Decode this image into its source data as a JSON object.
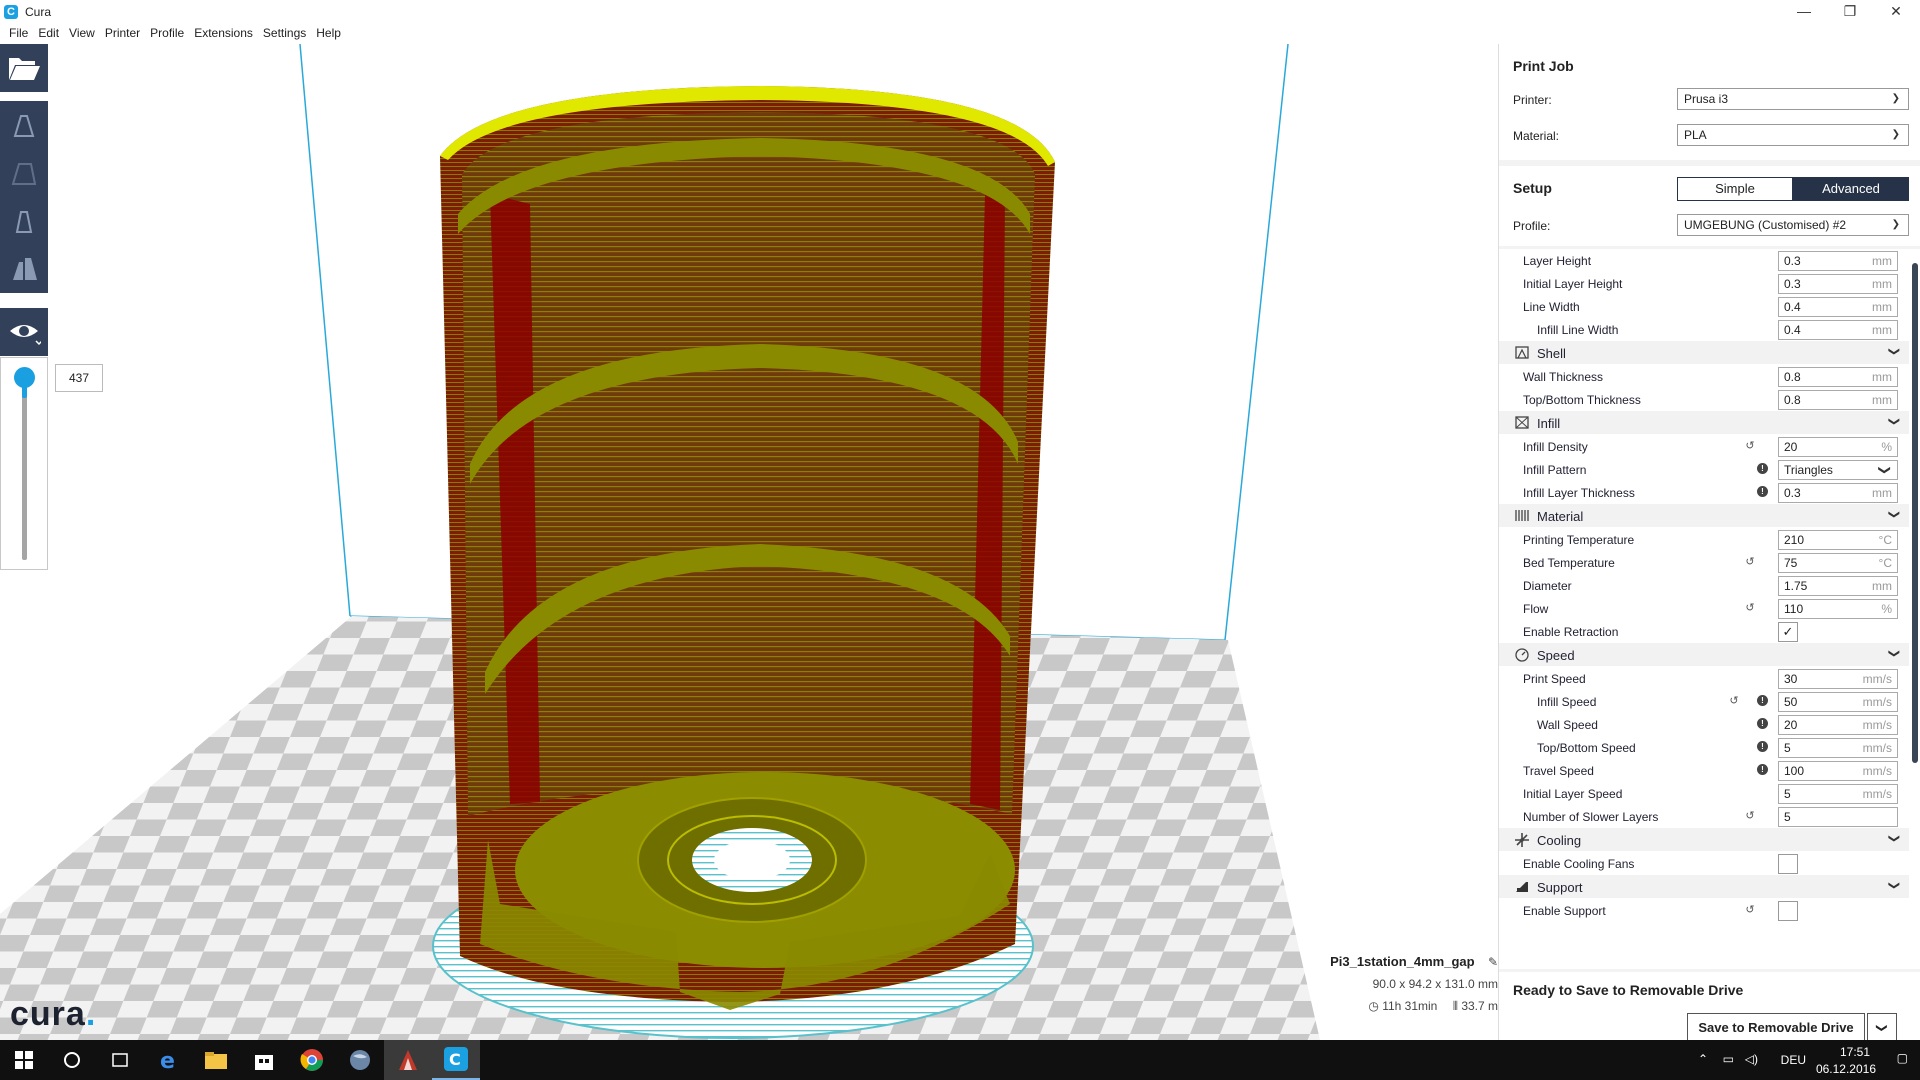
{
  "window": {
    "title": "Cura",
    "logo_letter": "C",
    "minimize": "—",
    "maximize": "❐",
    "close": "✕"
  },
  "menu": [
    "File",
    "Edit",
    "View",
    "Printer",
    "Profile",
    "Extensions",
    "Settings",
    "Help"
  ],
  "layer_view": {
    "current_layer": "437",
    "slider_position": 1.0
  },
  "logo": {
    "text": "cura",
    "dot": "."
  },
  "job": {
    "name": "Pi3_1station_4mm_gap",
    "dimensions": "90.0 x 94.2 x 131.0 mm",
    "time": "11h 31min",
    "filament": "33.7 m"
  },
  "print_job": {
    "heading": "Print Job",
    "printer_label": "Printer:",
    "printer_value": "Prusa i3",
    "material_label": "Material:",
    "material_value": "PLA"
  },
  "setup": {
    "heading": "Setup",
    "mode_simple": "Simple",
    "mode_advanced": "Advanced",
    "active_mode": "Advanced",
    "profile_label": "Profile:",
    "profile_value": "UMGEBUNG (Customised) #2"
  },
  "settings": [
    {
      "kind": "setting",
      "label": "Layer Height",
      "indent": 1,
      "value": "0.3",
      "unit": "mm"
    },
    {
      "kind": "setting",
      "label": "Initial Layer Height",
      "indent": 1,
      "value": "0.3",
      "unit": "mm"
    },
    {
      "kind": "setting",
      "label": "Line Width",
      "indent": 1,
      "value": "0.4",
      "unit": "mm"
    },
    {
      "kind": "setting",
      "label": "Infill Line Width",
      "indent": 2,
      "value": "0.4",
      "unit": "mm"
    },
    {
      "kind": "category",
      "label": "Shell",
      "icon": "shell-icon"
    },
    {
      "kind": "setting",
      "label": "Wall Thickness",
      "indent": 1,
      "value": "0.8",
      "unit": "mm"
    },
    {
      "kind": "setting",
      "label": "Top/Bottom Thickness",
      "indent": 1,
      "value": "0.8",
      "unit": "mm"
    },
    {
      "kind": "category",
      "label": "Infill",
      "icon": "infill-icon"
    },
    {
      "kind": "setting",
      "label": "Infill Density",
      "indent": 1,
      "value": "20",
      "unit": "%",
      "reset": true
    },
    {
      "kind": "setting",
      "label": "Infill Pattern",
      "indent": 1,
      "value": "Triangles",
      "dropdown": true,
      "info": true
    },
    {
      "kind": "setting",
      "label": "Infill Layer Thickness",
      "indent": 1,
      "value": "0.3",
      "unit": "mm",
      "info": true
    },
    {
      "kind": "category",
      "label": "Material",
      "icon": "material-icon"
    },
    {
      "kind": "setting",
      "label": "Printing Temperature",
      "indent": 1,
      "value": "210",
      "unit": "°C"
    },
    {
      "kind": "setting",
      "label": "Bed Temperature",
      "indent": 1,
      "value": "75",
      "unit": "°C",
      "reset": true
    },
    {
      "kind": "setting",
      "label": "Diameter",
      "indent": 1,
      "value": "1.75",
      "unit": "mm"
    },
    {
      "kind": "setting",
      "label": "Flow",
      "indent": 1,
      "value": "110",
      "unit": "%",
      "reset": true
    },
    {
      "kind": "setting",
      "label": "Enable Retraction",
      "indent": 1,
      "checkbox": true,
      "checked": true
    },
    {
      "kind": "category",
      "label": "Speed",
      "icon": "speed-icon"
    },
    {
      "kind": "setting",
      "label": "Print Speed",
      "indent": 1,
      "value": "30",
      "unit": "mm/s"
    },
    {
      "kind": "setting",
      "label": "Infill Speed",
      "indent": 2,
      "value": "50",
      "unit": "mm/s",
      "reset": true,
      "info": true
    },
    {
      "kind": "setting",
      "label": "Wall Speed",
      "indent": 2,
      "value": "20",
      "unit": "mm/s",
      "info": true
    },
    {
      "kind": "setting",
      "label": "Top/Bottom Speed",
      "indent": 2,
      "value": "5",
      "unit": "mm/s",
      "info": true
    },
    {
      "kind": "setting",
      "label": "Travel Speed",
      "indent": 1,
      "value": "100",
      "unit": "mm/s",
      "info": true
    },
    {
      "kind": "setting",
      "label": "Initial Layer Speed",
      "indent": 1,
      "value": "5",
      "unit": "mm/s"
    },
    {
      "kind": "setting",
      "label": "Number of Slower Layers",
      "indent": 1,
      "value": "5",
      "unit": "",
      "reset": true
    },
    {
      "kind": "category",
      "label": "Cooling",
      "icon": "fan-icon"
    },
    {
      "kind": "setting",
      "label": "Enable Cooling Fans",
      "indent": 1,
      "checkbox": true,
      "checked": false
    },
    {
      "kind": "category",
      "label": "Support",
      "icon": "support-icon"
    },
    {
      "kind": "setting",
      "label": "Enable Support",
      "indent": 1,
      "checkbox": true,
      "checked": false,
      "reset": true
    }
  ],
  "output": {
    "status": "Ready to Save to Removable Drive",
    "button": "Save to Removable Drive"
  },
  "taskbar": {
    "language": "DEU",
    "time": "17:51",
    "date": "06.12.2016"
  },
  "colors": {
    "toolbar": "#32405a",
    "accent": "#1a9fe0",
    "wall": "#8b0000",
    "skin": "#8a8a00",
    "support_skirt": "#5ec8d0",
    "highlight": "#e8ec00"
  }
}
